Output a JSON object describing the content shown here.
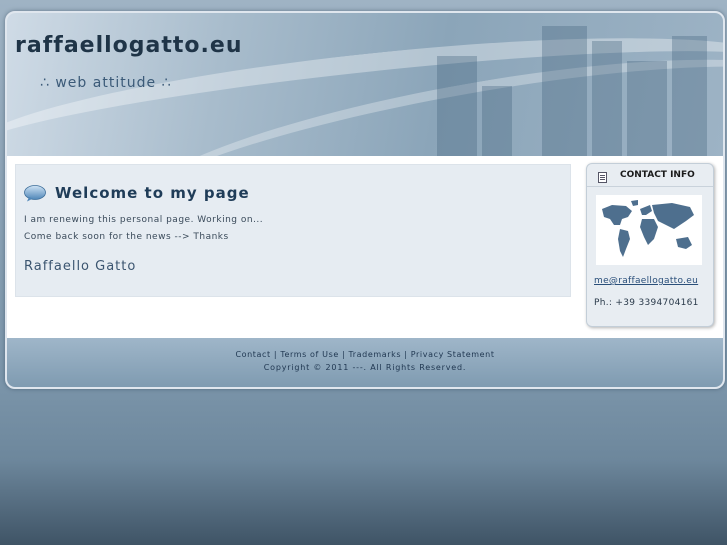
{
  "header": {
    "site_title": "raffaellogatto.eu",
    "tagline": "∴ web attitude ∴"
  },
  "main": {
    "heading": "Welcome to my page",
    "lines": [
      "I am renewing this personal page. Working on...",
      "Come back soon for the news --> Thanks"
    ],
    "signature": "Raffaello Gatto"
  },
  "contact": {
    "title": "CONTACT INFO",
    "email": "me@raffaellogatto.eu",
    "phone": "Ph.: +39 3394704161"
  },
  "footer": {
    "links": [
      "Contact",
      "Terms of Use",
      "Trademarks",
      "Privacy Statement"
    ],
    "separator": " | ",
    "copyright": "Copyright © 2011 ---. All Rights Reserved."
  },
  "icons": {
    "welcome": "speech-bubble-icon",
    "contact": "document-icon",
    "map": "world-map-image"
  },
  "colors": {
    "heading": "#1f3c58",
    "link": "#2a4f7a",
    "content_bg": "#e6ecf2"
  }
}
